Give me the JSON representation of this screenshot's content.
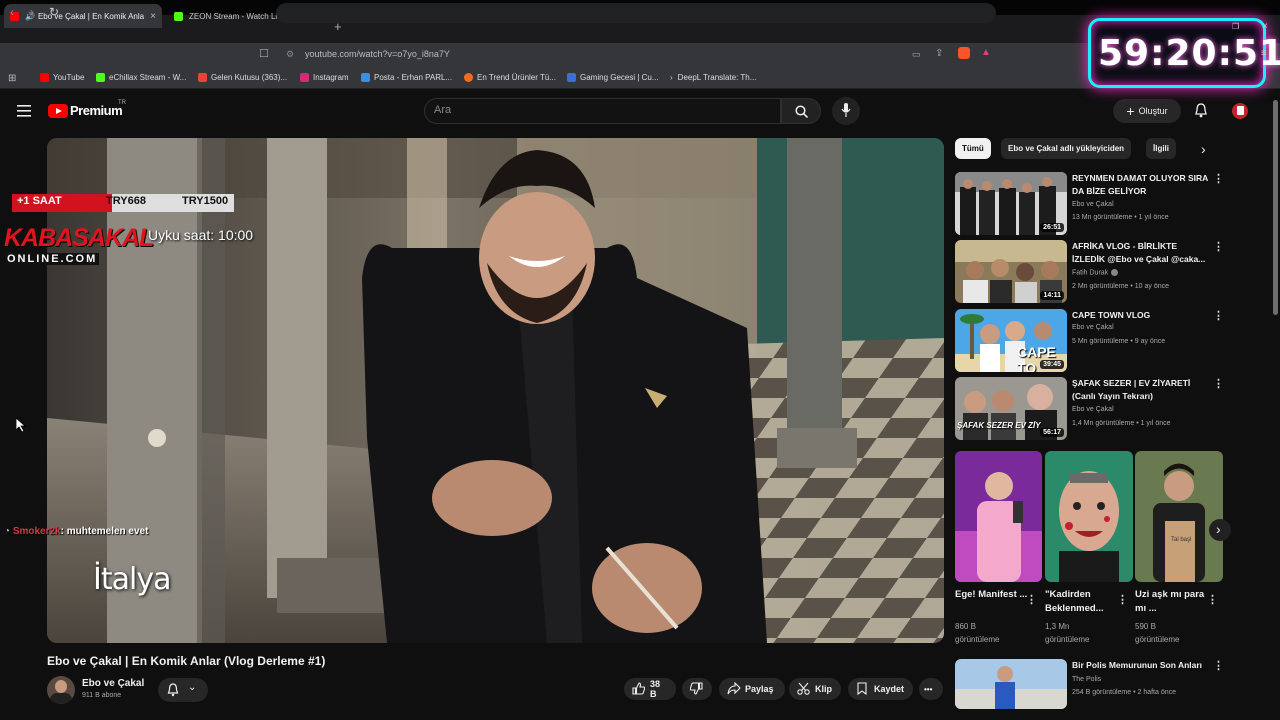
{
  "browser": {
    "tabs": [
      {
        "label": "Ebo ve Çakal | En Komik Anlar",
        "close": "×"
      },
      {
        "label": "ZEON Stream - Watch Live on Kick"
      }
    ],
    "new_tab": "+",
    "url": "youtube.com/watch?v=o7yo_i8na7Y",
    "bookmarks": [
      "YouTube",
      "eChillax Stream - W...",
      "Gelen Kutusu (363)...",
      "Instagram",
      "Posta - Erhan PARL...",
      "En Trend Ürünler Tü...",
      "Gaming Gecesi | Cu...",
      "DeepL Translate: Th..."
    ]
  },
  "header": {
    "logo_text": "Premium",
    "logo_sup": "TR",
    "search_placeholder": "Ara",
    "create_label": "Oluştur"
  },
  "player": {
    "overlay": {
      "bar1": "+1 SAAT",
      "bar2": "TRY668",
      "bar3": "TRY1500",
      "brand_line1": "KABASAKAL",
      "brand_line2": "ONLINE.COM",
      "sleep_time": "Uyku saat: 10:00",
      "chat_user": "Smoker2k",
      "chat_message": ": muhtemelen evet"
    },
    "caption": "İtalya"
  },
  "video_info": {
    "title": "Ebo ve Çakal | En Komik Anlar (Vlog Derleme #1)",
    "channel": "Ebo ve Çakal",
    "subscribers": "911 B abone",
    "likes": "38 B",
    "share": "Paylaş",
    "clip": "Klip",
    "save": "Kaydet",
    "more": "•••"
  },
  "chips": [
    "Tümü",
    "Ebo ve Çakal adlı yükleyiciden",
    "İlgili"
  ],
  "related": [
    {
      "title": "REYNMEN DAMAT OLUYOR SIRA DA BİZE GELİYOR",
      "channel": "Ebo ve Çakal",
      "meta": "13 Mn görüntüleme • 1 yıl önce",
      "duration": "26:51"
    },
    {
      "title": "AFRİKA VLOG - BİRLİKTE İZLEDİK @Ebo ve Çakal @caka...",
      "channel": "Fatih Durak",
      "meta": "2 Mn görüntüleme • 10 ay önce",
      "duration": "14:11"
    },
    {
      "title": "CAPE TOWN VLOG",
      "channel": "Ebo ve Çakal",
      "meta": "5 Mn görüntüleme • 9 ay önce",
      "duration": "39:45"
    },
    {
      "title": "ŞAFAK SEZER | EV ZİYARETİ (Canlı Yayın Tekrarı)",
      "channel": "Ebo ve Çakal",
      "meta": "1,4 Mn görüntüleme • 1 yıl önce",
      "duration": "56:17"
    }
  ],
  "shorts": [
    {
      "title": "Ege! Manifest ...",
      "views": "860 B görüntüleme"
    },
    {
      "title": "\"Kadirden Beklenmed...",
      "views": "1,3 Mn görüntüleme"
    },
    {
      "title": "Uzi aşk mı para mı ...",
      "views": "590 B görüntüleme"
    }
  ],
  "related_bottom": {
    "title": "Bir Polis Memurunun Son Anları",
    "channel": "The Polis",
    "meta": "254 B görüntüleme • 2 hafta önce"
  },
  "timer": "59:20:51",
  "thumb_texts": {
    "cape": "CAPE TO",
    "safak": "ŞAFAK SEZER EV ZİY",
    "short_badge": "Tal başl"
  }
}
